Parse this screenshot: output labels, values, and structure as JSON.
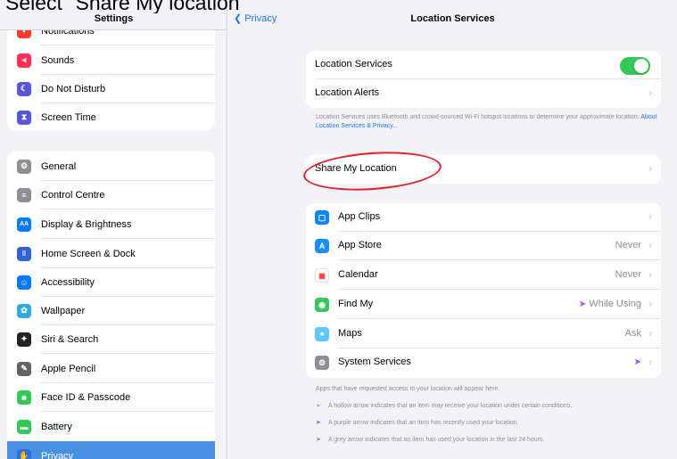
{
  "caption": "Select \"Share My location\"",
  "left": {
    "title": "Settings",
    "group1": [
      {
        "label": "Notifications",
        "icon": "notifications-icon",
        "color": "#ff3b30"
      },
      {
        "label": "Sounds",
        "icon": "sounds-icon",
        "color": "#ff2d55"
      },
      {
        "label": "Do Not Disturb",
        "icon": "moon-icon",
        "color": "#5856d6"
      },
      {
        "label": "Screen Time",
        "icon": "hourglass-icon",
        "color": "#5856d6"
      }
    ],
    "group2": [
      {
        "label": "General",
        "icon": "gear-icon",
        "color": "#8e8e93"
      },
      {
        "label": "Control Centre",
        "icon": "switches-icon",
        "color": "#8e8e93"
      },
      {
        "label": "Display & Brightness",
        "icon": "text-size-icon",
        "color": "#007aff"
      },
      {
        "label": "Home Screen & Dock",
        "icon": "grid-icon",
        "color": "#3062d6"
      },
      {
        "label": "Accessibility",
        "icon": "accessibility-icon",
        "color": "#007aff"
      },
      {
        "label": "Wallpaper",
        "icon": "flower-icon",
        "color": "#34aadc"
      },
      {
        "label": "Siri & Search",
        "icon": "siri-icon",
        "color": "#222"
      },
      {
        "label": "Apple Pencil",
        "icon": "pencil-icon",
        "color": "#636366"
      },
      {
        "label": "Face ID & Passcode",
        "icon": "face-id-icon",
        "color": "#34c759"
      },
      {
        "label": "Battery",
        "icon": "battery-icon",
        "color": "#34c759"
      },
      {
        "label": "Privacy",
        "icon": "hand-icon",
        "color": "#007aff"
      }
    ]
  },
  "right": {
    "back_label": "Privacy",
    "title": "Location Services",
    "location_services_label": "Location Services",
    "location_services_on": true,
    "location_alerts_label": "Location Alerts",
    "info_text": "Location Services uses Bluetooth and crowd-sourced Wi-Fi hotspot locations to determine your approximate location.",
    "info_link": "About Location Services & Privacy...",
    "share_label": "Share My Location",
    "apps": [
      {
        "name": "App Clips",
        "value": "",
        "icon": "app-clips-icon",
        "color": "#0a84ff",
        "arrow": false
      },
      {
        "name": "App Store",
        "value": "Never",
        "icon": "app-store-icon",
        "color": "#1a8cff",
        "arrow": false
      },
      {
        "name": "Calendar",
        "value": "Never",
        "icon": "calendar-icon",
        "color": "#ffffff",
        "arrow": false
      },
      {
        "name": "Find My",
        "value": "While Using",
        "icon": "find-my-icon",
        "color": "#34c759",
        "arrow": true
      },
      {
        "name": "Maps",
        "value": "Ask",
        "icon": "maps-icon",
        "color": "#5ac8fa",
        "arrow": false
      },
      {
        "name": "System Services",
        "value": "",
        "icon": "gear-icon",
        "color": "#8e8e93",
        "arrow": true
      }
    ],
    "footer_intro": "Apps that have requested access to your location will appear here.",
    "legend": [
      {
        "text": "A hollow arrow indicates that an item may receive your location under certain conditions.",
        "kind": "hollow"
      },
      {
        "text": "A purple arrow indicates that an item has recently used your location.",
        "kind": "purple"
      },
      {
        "text": "A grey arrow indicates that an item has used your location in the last 24 hours.",
        "kind": "grey"
      }
    ]
  }
}
